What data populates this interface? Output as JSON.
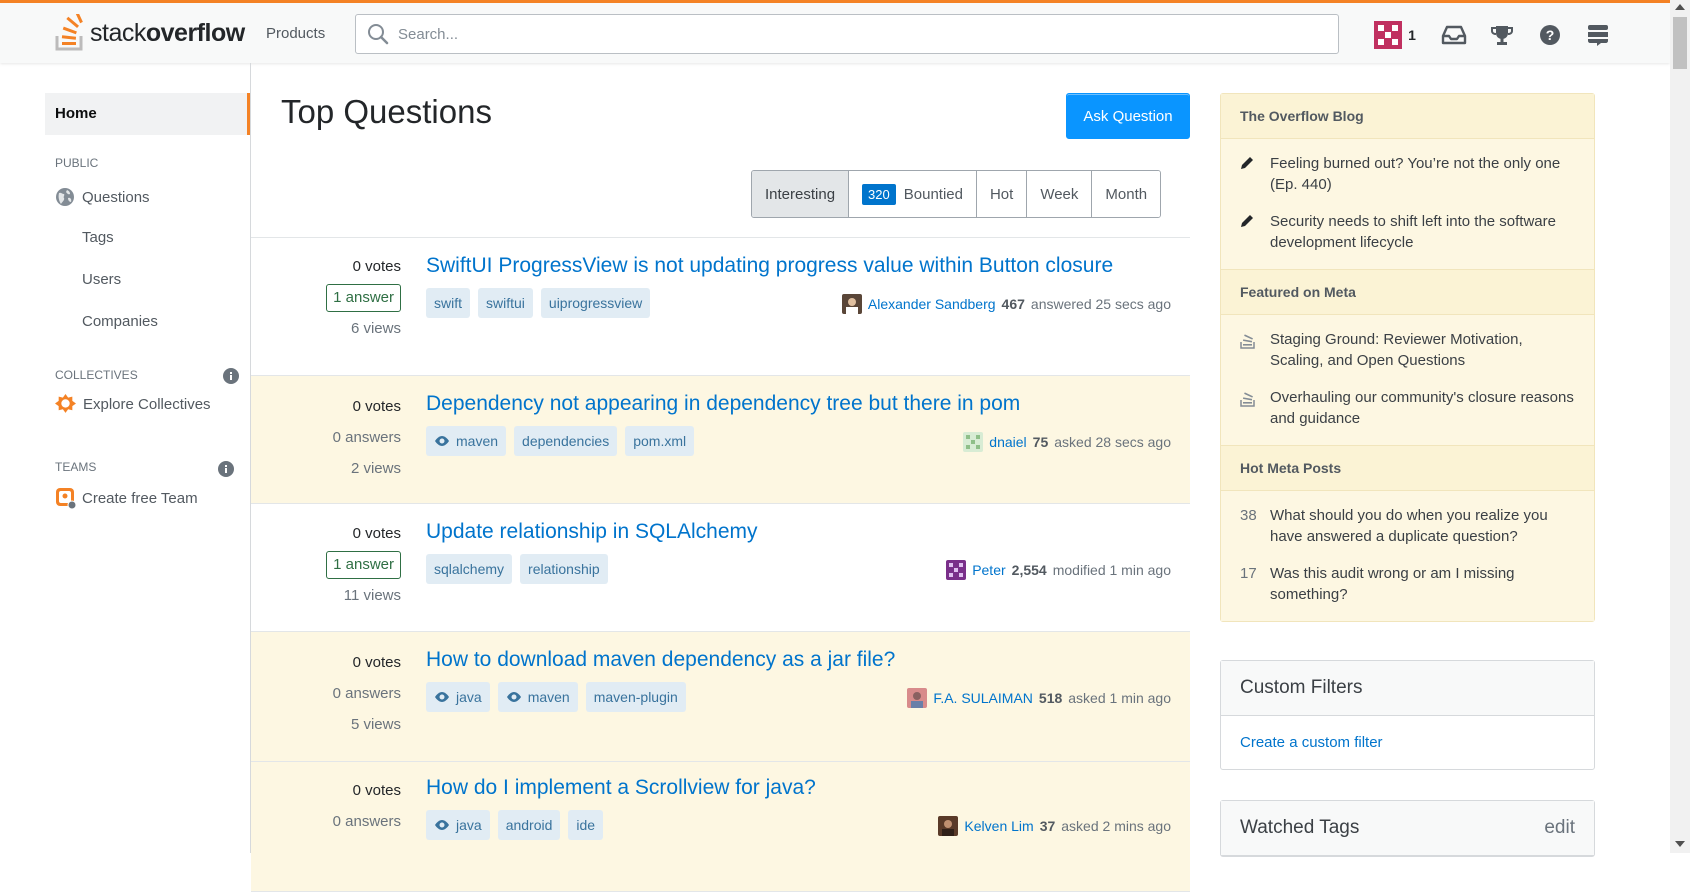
{
  "header": {
    "logo_plain": "stack",
    "logo_bold": "overflow",
    "products": "Products",
    "search_placeholder": "Search...",
    "reputation": "1",
    "accent_color": "#f48225"
  },
  "sidebar": {
    "home": "Home",
    "public_label": "PUBLIC",
    "questions": "Questions",
    "tags": "Tags",
    "users": "Users",
    "companies": "Companies",
    "collectives_label": "COLLECTIVES",
    "explore_collectives": "Explore Collectives",
    "teams_label": "TEAMS",
    "create_team": "Create free Team"
  },
  "main": {
    "title": "Top Questions",
    "ask_button": "Ask Question",
    "filters": {
      "interesting": "Interesting",
      "bounty_count": "320",
      "bountied": "Bountied",
      "hot": "Hot",
      "week": "Week",
      "month": "Month"
    },
    "questions": [
      {
        "votes": "0 votes",
        "answers": "1 answer",
        "views": "6 views",
        "title": "SwiftUI ProgressView is not updating progress value within Button closure",
        "tags": [
          "swift",
          "swiftui",
          "uiprogressview"
        ],
        "user": "Alexander Sandberg",
        "rep": "467",
        "action": "answered 25 secs ago"
      },
      {
        "votes": "0 votes",
        "answers": "0 answers",
        "views": "2 views",
        "title": "Dependency not appearing in dependency tree but there in pom",
        "tags": [
          "maven",
          "dependencies",
          "pom.xml"
        ],
        "user": "dnaiel",
        "rep": "75",
        "action": "asked 28 secs ago"
      },
      {
        "votes": "0 votes",
        "answers": "1 answer",
        "views": "11 views",
        "title": "Update relationship in SQLAlchemy",
        "tags": [
          "sqlalchemy",
          "relationship"
        ],
        "user": "Peter",
        "rep": "2,554",
        "action": "modified 1 min ago"
      },
      {
        "votes": "0 votes",
        "answers": "0 answers",
        "views": "5 views",
        "title": "How to download maven dependency as a jar file?",
        "tags": [
          "java",
          "maven",
          "maven-plugin"
        ],
        "user": "F.A. SULAIMAN",
        "rep": "518",
        "action": "asked 1 min ago"
      },
      {
        "votes": "0 votes",
        "answers": "0 answers",
        "views": "",
        "title": "How do I implement a Scrollview for java?",
        "tags": [
          "java",
          "android",
          "ide"
        ],
        "user": "Kelven Lim",
        "rep": "37",
        "action": "asked 2 mins ago"
      }
    ]
  },
  "right": {
    "blog_title": "The Overflow Blog",
    "blog_items": [
      "Feeling burned out? You’re not the only one (Ep. 440)",
      "Security needs to shift left into the software development lifecycle"
    ],
    "meta_title": "Featured on Meta",
    "meta_items": [
      "Staging Ground: Reviewer Motivation, Scaling, and Open Questions",
      "Overhauling our community's closure reasons and guidance"
    ],
    "hot_title": "Hot Meta Posts",
    "hot_items": [
      {
        "count": "38",
        "text": "What should you do when you realize you have answered a duplicate question?"
      },
      {
        "count": "17",
        "text": "Was this audit wrong or am I missing something?"
      }
    ],
    "custom_filters_title": "Custom Filters",
    "custom_filters_link": "Create a custom filter",
    "watched_tags_title": "Watched Tags",
    "watched_tags_edit": "edit"
  }
}
